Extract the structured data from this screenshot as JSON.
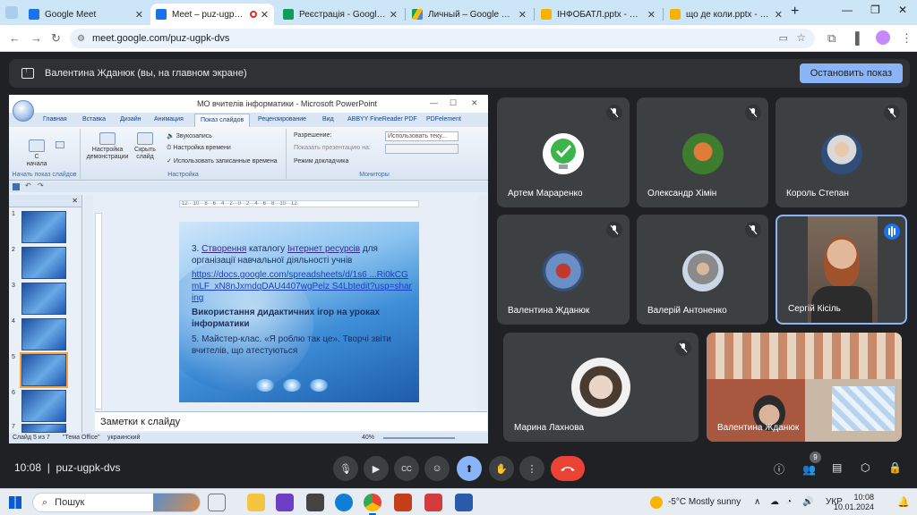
{
  "browser": {
    "tabs": [
      {
        "label": "Google Meet",
        "color": "#1a73e8"
      },
      {
        "label": "Meet – puz-ugpk-dvs",
        "color": "#1a73e8"
      },
      {
        "label": "Реєстрація - Google Табл",
        "color": "#0f9d58"
      },
      {
        "label": "Личный – Google Диск",
        "color": "#fbbc04"
      },
      {
        "label": "ІНФОБАТЛ.pptx - Google",
        "color": "#f4b400"
      },
      {
        "label": "що де коли.pptx - Google",
        "color": "#f4b400"
      }
    ],
    "new_tab": "+",
    "url": "meet.google.com/puz-ugpk-dvs"
  },
  "presentation_bar": {
    "text": "Валентина Жданюк (вы, на главном экране)",
    "stop_button": "Остановить показ"
  },
  "shared_screen": {
    "window_title": "МО вчителів інформатики - Microsoft PowerPoint",
    "ribbon_tabs": [
      "Главная",
      "Вставка",
      "Дизайн",
      "Анимация",
      "Показ слайдов",
      "Рецензирование",
      "Вид",
      "ABBYY FineReader PDF",
      "PDFelement"
    ],
    "group_start": {
      "label": "Начать показ слайдов",
      "btn1": "С начала"
    },
    "group_setup": {
      "label": "Настройка",
      "btn1": "Настройка демонстрации",
      "btn2": "Скрыть слайд",
      "opt1": "Звукозапись",
      "opt2": "Настройка времени",
      "opt3": "Использовать записанные времена"
    },
    "group_monitors": {
      "label": "Мониторы",
      "res_label": "Разрешение:",
      "res_value": "Использовать теку...",
      "show_on": "Показать презентацию на:",
      "presenter": "Режим докладчика"
    },
    "slide_numbers": [
      "1",
      "2",
      "3",
      "4",
      "5",
      "6",
      "7"
    ],
    "ruler": "·12···10···8···6···4···2···0···2···4···6···8···10···12·",
    "slide_text": {
      "item3_prefix": "3. ",
      "item3_a": "Створення",
      "item3_b": " каталогу ",
      "item3_c": "Інтернет ресурсів",
      "item3_d": " для організації навчальної діяльності учнів",
      "link": "https://docs.google.com/spreadsheets/d/1s6 ...Ri0kCGmLF_xN8nJxmdqDAU4407wgPelz S4Lbtedit?usp=sharing",
      "item4": "Використання дидактичних ігор на уроках інформатики",
      "item5": "5. Майстер-клас. «Я роблю так це». Творчі звіти вчителів, що атестуються"
    },
    "notes_placeholder": "Заметки к слайду",
    "status": {
      "slide": "Слайд 5 из 7",
      "theme": "\"Тема Office\"",
      "lang": "украинский",
      "zoom": "40%"
    }
  },
  "participants": [
    {
      "name": "Артем Мараренко"
    },
    {
      "name": "Олександр Хімін"
    },
    {
      "name": "Король Степан"
    },
    {
      "name": "Валентина Жданюк"
    },
    {
      "name": "Валерій Антоненко"
    },
    {
      "name": "Сергій Кісіль"
    },
    {
      "name": "Марина Лахнова"
    },
    {
      "name": "Валентина Жданюк"
    }
  ],
  "meet_bar": {
    "time": "10:08",
    "code": "puz-ugpk-dvs",
    "participants_count": "9"
  },
  "taskbar": {
    "search": "Пошук",
    "weather": "-5°C  Mostly sunny",
    "lang": "УКР",
    "time": "10:08",
    "date": "10.01.2024"
  }
}
